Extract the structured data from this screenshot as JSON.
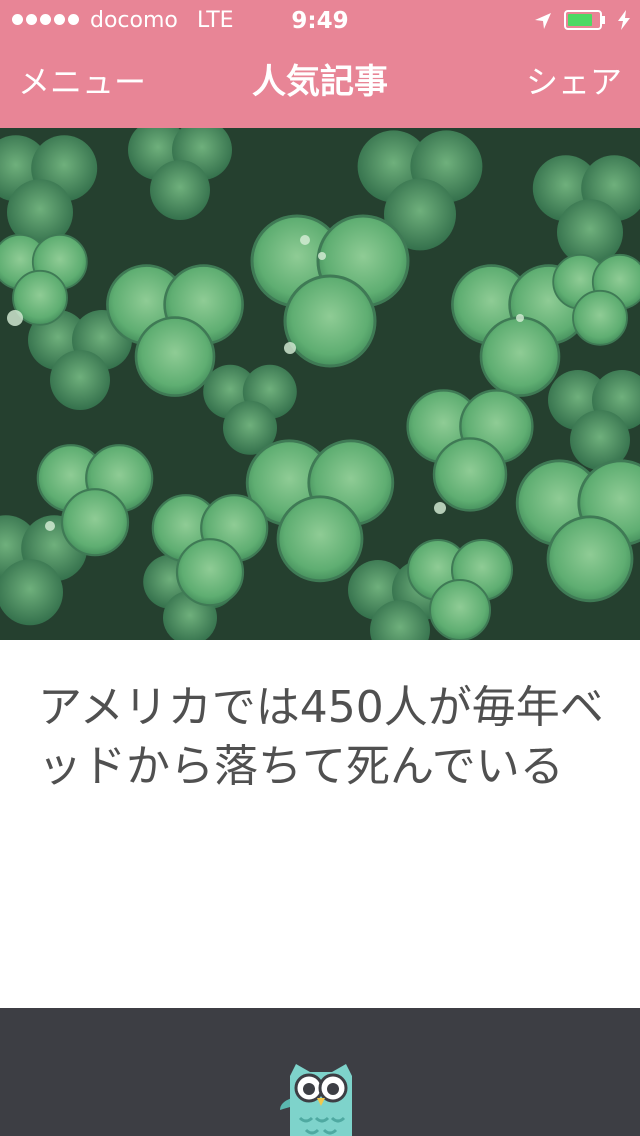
{
  "status_bar": {
    "carrier": "docomo",
    "network": "LTE",
    "time": "9:49",
    "signal_bars": 5
  },
  "nav": {
    "left_label": "メニュー",
    "title": "人気記事",
    "right_label": "シェア"
  },
  "hero": {
    "subject": "clover-leaves-photo"
  },
  "article": {
    "title": "アメリカでは450人が毎年ベッドから落ちて死んでいる"
  },
  "footer": {
    "logo": "owl-icon"
  },
  "colors": {
    "header": "#e88596",
    "footer": "#3d3e44",
    "title_text": "#505050",
    "battery_fill": "#4cd964",
    "owl": "#7ed3cb"
  }
}
